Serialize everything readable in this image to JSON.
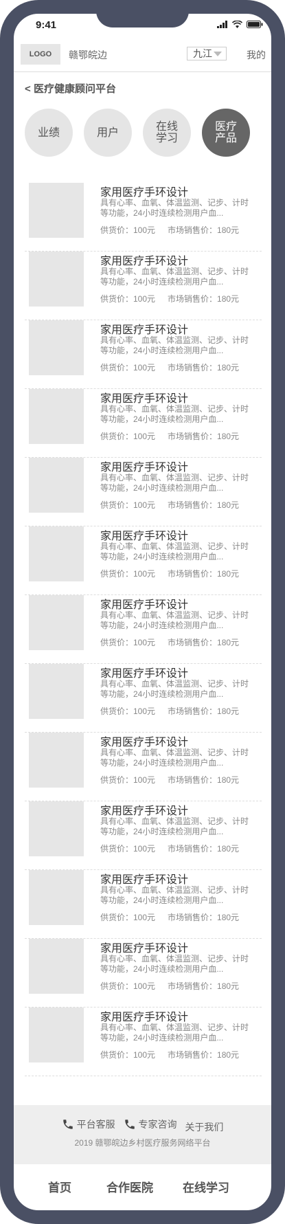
{
  "status": {
    "time": "9:41"
  },
  "header": {
    "logo": "LOGO",
    "brand": "赣鄂皖边",
    "city": "九江",
    "mine": "我的"
  },
  "breadcrumb": {
    "back": "<",
    "title": "医疗健康顾问平台"
  },
  "categories": [
    {
      "label": "业绩",
      "active": false
    },
    {
      "label": "用户",
      "active": false
    },
    {
      "label": "在线学习",
      "active": false
    },
    {
      "label": "医疗产品",
      "active": true
    }
  ],
  "products": [
    {
      "title": "家用医疗手环设计",
      "desc": "具有心率、血氧、体温监测、记步、计时等功能，24小时连续检测用户血...",
      "supply": "供货价：100元",
      "market": "市场销售价：180元"
    },
    {
      "title": "家用医疗手环设计",
      "desc": "具有心率、血氧、体温监测、记步、计时等功能，24小时连续检测用户血...",
      "supply": "供货价：100元",
      "market": "市场销售价：180元"
    },
    {
      "title": "家用医疗手环设计",
      "desc": "具有心率、血氧、体温监测、记步、计时等功能，24小时连续检测用户血...",
      "supply": "供货价：100元",
      "market": "市场销售价：180元"
    },
    {
      "title": "家用医疗手环设计",
      "desc": "具有心率、血氧、体温监测、记步、计时等功能，24小时连续检测用户血...",
      "supply": "供货价：100元",
      "market": "市场销售价：180元"
    },
    {
      "title": "家用医疗手环设计",
      "desc": "具有心率、血氧、体温监测、记步、计时等功能，24小时连续检测用户血...",
      "supply": "供货价：100元",
      "market": "市场销售价：180元"
    },
    {
      "title": "家用医疗手环设计",
      "desc": "具有心率、血氧、体温监测、记步、计时等功能，24小时连续检测用户血...",
      "supply": "供货价：100元",
      "market": "市场销售价：180元"
    },
    {
      "title": "家用医疗手环设计",
      "desc": "具有心率、血氧、体温监测、记步、计时等功能，24小时连续检测用户血...",
      "supply": "供货价：100元",
      "market": "市场销售价：180元"
    },
    {
      "title": "家用医疗手环设计",
      "desc": "具有心率、血氧、体温监测、记步、计时等功能，24小时连续检测用户血...",
      "supply": "供货价：100元",
      "market": "市场销售价：180元"
    },
    {
      "title": "家用医疗手环设计",
      "desc": "具有心率、血氧、体温监测、记步、计时等功能，24小时连续检测用户血...",
      "supply": "供货价：100元",
      "market": "市场销售价：180元"
    },
    {
      "title": "家用医疗手环设计",
      "desc": "具有心率、血氧、体温监测、记步、计时等功能，24小时连续检测用户血...",
      "supply": "供货价：100元",
      "market": "市场销售价：180元"
    },
    {
      "title": "家用医疗手环设计",
      "desc": "具有心率、血氧、体温监测、记步、计时等功能，24小时连续检测用户血...",
      "supply": "供货价：100元",
      "market": "市场销售价：180元"
    },
    {
      "title": "家用医疗手环设计",
      "desc": "具有心率、血氧、体温监测、记步、计时等功能，24小时连续检测用户血...",
      "supply": "供货价：100元",
      "market": "市场销售价：180元"
    },
    {
      "title": "家用医疗手环设计",
      "desc": "具有心率、血氧、体温监测、记步、计时等功能，24小时连续检测用户血...",
      "supply": "供货价：100元",
      "market": "市场销售价：180元"
    }
  ],
  "footer": {
    "links": [
      {
        "label": "平台客服",
        "icon": "phone-icon"
      },
      {
        "label": "专家咨询",
        "icon": "phone-icon"
      },
      {
        "label": "关于我们",
        "icon": ""
      }
    ],
    "copyright": "2019 赣鄂皖边乡村医疗服务网络平台"
  },
  "tabbar": {
    "items": [
      "首页",
      "合作医院",
      "在线学习"
    ]
  },
  "colors": {
    "frame": "#4a5064",
    "active_category": "#666666",
    "placeholder": "#e6e6e6"
  }
}
